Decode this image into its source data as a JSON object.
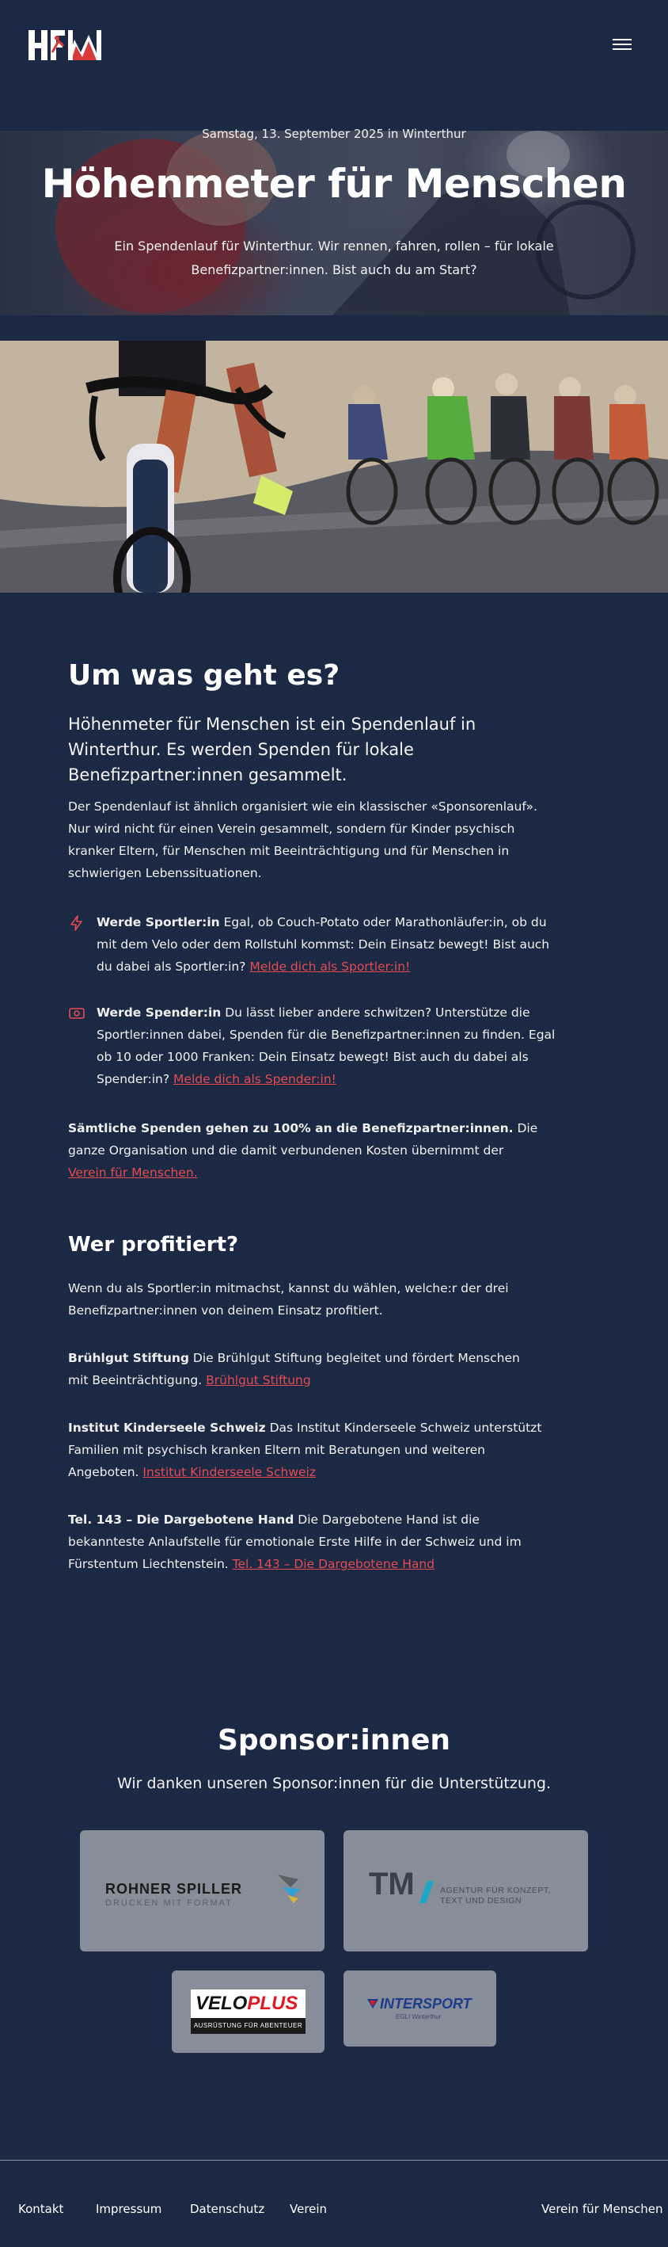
{
  "header": {
    "logo_text": "HfM",
    "menu_label": "Menü"
  },
  "hero": {
    "date": "Samstag, 13. September 2025 in Winterthur",
    "title": "Höhenmeter für Menschen",
    "subtitle": "Ein Spendenlauf für Winterthur. Wir rennen, fahren, rollen – für lokale Benefizpartner:innen. Bist auch du am Start?"
  },
  "about": {
    "heading": "Um was geht es?",
    "lead": "Höhenmeter für Menschen ist ein Spendenlauf in Winterthur. Es werden Spenden für lokale Benefizpartner:innen gesammelt.",
    "intro": "Der Spendenlauf ist ähnlich organisiert wie ein klassischer «Sponsorenlauf». Nur wird nicht für einen Verein gesammelt, sondern für Kinder psychisch kranker Eltern, für Menschen mit Beeinträchtigung und für Menschen in schwierigen Lebenssituationen.",
    "features": [
      {
        "icon": "bolt-icon",
        "title": "Werde Sportler:in",
        "text": " Egal, ob Couch-Potato oder Marathonläufer:in, ob du mit dem Velo oder dem Rollstuhl kommst: Dein Einsatz bewegt! Bist auch du dabei als Sportler:in? ",
        "link": "Melde dich als Sportler:in!"
      },
      {
        "icon": "money-icon",
        "title": "Werde Spender:in",
        "text": " Du lässt lieber andere schwitzen? Unterstütze die Sportler:innen dabei, Spenden für die Benefizpartner:innen zu finden. Egal ob 10 oder 1000 Franken: Dein Einsatz bewegt! Bist auch du dabei als Spender:in? ",
        "link": "Melde dich als Spender:in!"
      }
    ],
    "note_bold": "Sämtliche Spenden gehen zu 100% an die Benefizpartner:innen.",
    "note_text": " Die ganze Organisation und die damit verbundenen Kosten übernimmt der ",
    "note_link": "Verein für Menschen."
  },
  "beneficiaries": {
    "heading": "Wer profitiert?",
    "intro": "Wenn du als Sportler:in mitmachst, kannst du wählen, welche:r der drei Benefizpartner:innen von deinem Einsatz profitiert.",
    "items": [
      {
        "name": "Brühlgut Stiftung",
        "text": " Die Brühlgut Stiftung begleitet und fördert Menschen mit Beeinträchtigung. ",
        "link": "Brühlgut Stiftung"
      },
      {
        "name": "Institut Kinderseele Schweiz",
        "text": " Das Institut Kinderseele Schweiz unterstützt Familien mit psychisch kranken Eltern mit Beratungen und weiteren Angeboten. ",
        "link": "Institut Kinderseele Schweiz"
      },
      {
        "name": "Tel. 143 – Die Dargebotene Hand",
        "text": " Die Dargebotene Hand ist die bekannteste Anlaufstelle für emotionale Erste Hilfe in der Schweiz und im Fürstentum Liechtenstein. ",
        "link": "Tel. 143 – Die Dargebotene Hand"
      }
    ]
  },
  "sponsors": {
    "heading": "Sponsor:innen",
    "subtitle": "Wir danken unseren Sponsor:innen für die Unterstützung.",
    "logos": [
      {
        "name": "ROHNER SPILLER",
        "tagline": "DRUCKEN MIT FORMAT"
      },
      {
        "name": "TM",
        "tagline": "AGENTUR FÜR KONZEPT, TEXT UND DESIGN"
      },
      {
        "name_a": "VELO",
        "name_b": "PLUS",
        "tagline": "AUSRÜSTUNG FÜR ABENTEUER"
      },
      {
        "name": "INTERSPORT",
        "tagline": "EGLI Winterthur"
      }
    ]
  },
  "footer": {
    "links": [
      "Kontakt",
      "Impressum",
      "Datenschutz",
      "Verein"
    ],
    "right_link": "Verein für Menschen"
  },
  "colors": {
    "background": "#1c2944",
    "accent": "#e34b50",
    "card": "#878d99"
  }
}
